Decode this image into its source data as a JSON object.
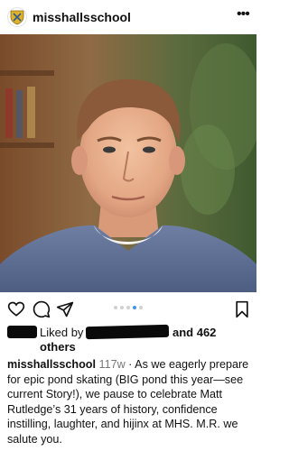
{
  "header": {
    "username": "misshallsschool"
  },
  "carousel": {
    "count": 5,
    "active": 3
  },
  "likes": {
    "liked_by_label": "Liked by",
    "and_count": "and 462",
    "others_label": "others"
  },
  "caption": {
    "username": "misshallsschool",
    "time": "117w",
    "text": "· As we eagerly prepare for epic pond skating (BIG pond this year—see current Story!), we pause to celebrate Matt Rutledge’s 31 years of history, confidence instilling, laughter, and hijinx at MHS. M.R. we salute you."
  },
  "icons": [
    "school-crest-icon",
    "more-icon",
    "heart-icon",
    "comment-icon",
    "share-icon",
    "bookmark-icon"
  ]
}
